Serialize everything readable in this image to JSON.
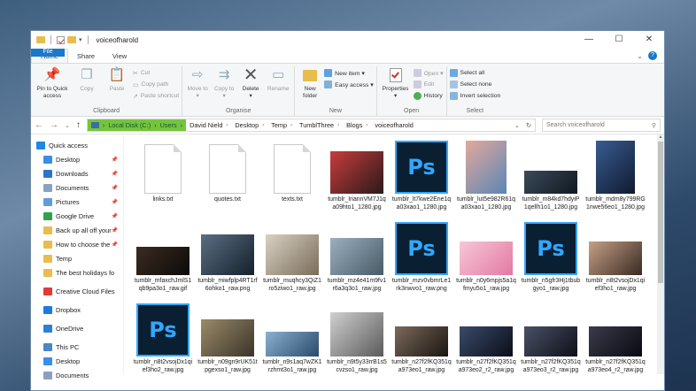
{
  "title_bar": {
    "title": "voiceofharold",
    "buttons": [
      "—",
      "☐",
      "✕"
    ]
  },
  "tabs": [
    "File",
    "Home",
    "Share",
    "View"
  ],
  "ribbon": {
    "clipboard": {
      "label": "Clipboard",
      "pin": "Pin to Quick access",
      "copy": "Copy",
      "paste": "Paste",
      "cut": "Cut",
      "copy_path": "Copy path",
      "paste_shortcut": "Paste shortcut"
    },
    "organise": {
      "label": "Organise",
      "move_to": "Move to",
      "copy_to": "Copy to",
      "delete": "Delete",
      "rename": "Rename"
    },
    "new": {
      "label": "New",
      "new_folder": "New folder",
      "new_item": "New item ▾",
      "easy_access": "Easy access ▾"
    },
    "open": {
      "label": "Open",
      "properties": "Properties",
      "open": "Open ▾",
      "edit": "Edit",
      "history": "History"
    },
    "select": {
      "label": "Select",
      "select_all": "Select all",
      "select_none": "Select none",
      "invert": "Invert selection"
    }
  },
  "address": {
    "crumbs": [
      "Local Disk (C:)",
      "Users",
      "David Nield",
      "Desktop",
      "Temp",
      "TumblThree",
      "Blogs",
      "voiceofharold"
    ],
    "search_placeholder": "Search voiceofharold"
  },
  "sidebar": [
    {
      "label": "Quick access",
      "icon": "star-icon",
      "color": "#1e88e5",
      "top": true
    },
    {
      "label": "Desktop",
      "icon": "desktop-icon",
      "color": "#3a8ee6",
      "pin": true
    },
    {
      "label": "Downloads",
      "icon": "download-icon",
      "color": "#2c74c7",
      "pin": true
    },
    {
      "label": "Documents",
      "icon": "documents-icon",
      "color": "#8aa2bf",
      "pin": true
    },
    {
      "label": "Pictures",
      "icon": "pictures-icon",
      "color": "#5f9ed8",
      "pin": true
    },
    {
      "label": "Google Drive",
      "icon": "google-drive-icon",
      "color": "#2fa14f",
      "pin": true
    },
    {
      "label": "Back up all off your",
      "icon": "folder-icon",
      "color": "#e8bd4c",
      "pin": true
    },
    {
      "label": "How to choose the",
      "icon": "folder-icon",
      "color": "#e8bd4c",
      "pin": true
    },
    {
      "label": "Temp",
      "icon": "folder-icon",
      "color": "#e8bd4c",
      "pin": false
    },
    {
      "label": "The best holidays fo",
      "icon": "folder-icon",
      "color": "#e8bd4c",
      "pin": false
    },
    {
      "label": "Creative Cloud Files",
      "icon": "creative-cloud-icon",
      "color": "#e03a3a",
      "gap": true
    },
    {
      "label": "Dropbox",
      "icon": "dropbox-icon",
      "color": "#1f7ae0",
      "gap": true
    },
    {
      "label": "OneDrive",
      "icon": "onedrive-icon",
      "color": "#2b80d8",
      "gap": true
    },
    {
      "label": "This PC",
      "icon": "computer-icon",
      "color": "#4a86c8",
      "gap": true
    },
    {
      "label": "Desktop",
      "icon": "desktop-icon",
      "color": "#3a8ee6"
    },
    {
      "label": "Documents",
      "icon": "documents-icon",
      "color": "#8aa2bf"
    }
  ],
  "files": [
    {
      "name": "links.txt",
      "kind": "doc"
    },
    {
      "name": "quotes.txt",
      "kind": "doc"
    },
    {
      "name": "texts.txt",
      "kind": "doc"
    },
    {
      "name": "tumblr_IriannVM7J1qa09hto1_1280.jpg",
      "kind": "img",
      "w": 60,
      "h": 48,
      "c1": "#c83c3c",
      "c2": "#2a1a1a"
    },
    {
      "name": "tumblr_lt7kwe2Ene1qa03xao1_1280.jpg",
      "kind": "ps"
    },
    {
      "name": "tumblr_lut5e982R61qa03xao1_1280.jpg",
      "kind": "img",
      "w": 46,
      "h": 60,
      "c1": "#e3a89c",
      "c2": "#5a86b5"
    },
    {
      "name": "tumblr_m84kd7hdyiP1qellh1o1_1280.jpg",
      "kind": "img",
      "w": 60,
      "h": 26,
      "c1": "#3b4a5a",
      "c2": "#101820"
    },
    {
      "name": "tumblr_mdm8y799RG1nwe56eo1_1280.jpg",
      "kind": "img",
      "w": 44,
      "h": 60,
      "c1": "#385c90",
      "c2": "#101a30"
    },
    {
      "name": "tumblr_mfaxchJmlS1qb9pa3o1_raw.gif",
      "kind": "img",
      "w": 60,
      "h": 32,
      "c1": "#3a2c22",
      "c2": "#0d0a08"
    },
    {
      "name": "tumblr_miwfplp4RT1rf6ohko1_raw.png",
      "kind": "img",
      "w": 60,
      "h": 46,
      "c1": "#5a6e82",
      "c2": "#15202c"
    },
    {
      "name": "tumblr_muqhcy3QiZ1ro5ziwo1_raw.jpg",
      "kind": "img",
      "w": 60,
      "h": 46,
      "c1": "#d8d2c4",
      "c2": "#7a6c5a"
    },
    {
      "name": "tumblr_mz4e41m9fv1r6a3q3o1_raw.jpg",
      "kind": "img",
      "w": 60,
      "h": 42,
      "c1": "#9ab0c0",
      "c2": "#4a5a66"
    },
    {
      "name": "tumblr_mzv0vbmrLe1rk3nwvo1_raw.png",
      "kind": "ps"
    },
    {
      "name": "tumblr_n0y6mpjs5a1qfmyu5o1_raw.jpg",
      "kind": "img",
      "w": 60,
      "h": 38,
      "c1": "#f7c6d8",
      "c2": "#e27aa2"
    },
    {
      "name": "tumblr_n5gfr3Hj1tbubgyo1_raw.jpg",
      "kind": "ps"
    },
    {
      "name": "tumblr_n8t2vsojDx1qief3ho1_raw.jpg",
      "kind": "img",
      "w": 60,
      "h": 38,
      "c1": "#c4a086",
      "c2": "#3a2a22"
    },
    {
      "name": "tumblr_n8t2vsojDx1qief3ho2_raw.jpg",
      "kind": "ps"
    },
    {
      "name": "tumblr_n09gn9rUK51tpgexso1_raw.jpg",
      "kind": "img",
      "w": 60,
      "h": 42,
      "c1": "#9a8a6a",
      "c2": "#3a3428"
    },
    {
      "name": "tumblr_n9s1aq7wZK1rzhmt3o1_raw.jpg",
      "kind": "img",
      "w": 60,
      "h": 28,
      "c1": "#8ab0d0",
      "c2": "#2a4a6a"
    },
    {
      "name": "tumblr_n9t5y33rrB1s5cvzso1_raw.jpg",
      "kind": "img",
      "w": 60,
      "h": 50,
      "c1": "#d0d0d0",
      "c2": "#5a5a5a"
    },
    {
      "name": "tumblr_n27f2fKQ351qa973eo1_raw.jpg",
      "kind": "img",
      "w": 60,
      "h": 34,
      "c1": "#7a6a5a",
      "c2": "#1a1410"
    },
    {
      "name": "tumblr_n27f2fKQ351qa973eo2_r2_raw.jpg",
      "kind": "img",
      "w": 60,
      "h": 34,
      "c1": "#3a4a6a",
      "c2": "#0a0e18"
    },
    {
      "name": "tumblr_n27f2fKQ351qa973eo3_r2_raw.jpg",
      "kind": "img",
      "w": 60,
      "h": 34,
      "c1": "#4a5066",
      "c2": "#0e1018"
    },
    {
      "name": "tumblr_n27f2fKQ351qa973eo4_r2_raw.jpg",
      "kind": "img",
      "w": 60,
      "h": 34,
      "c1": "#3a3a4a",
      "c2": "#0a0a12"
    }
  ]
}
